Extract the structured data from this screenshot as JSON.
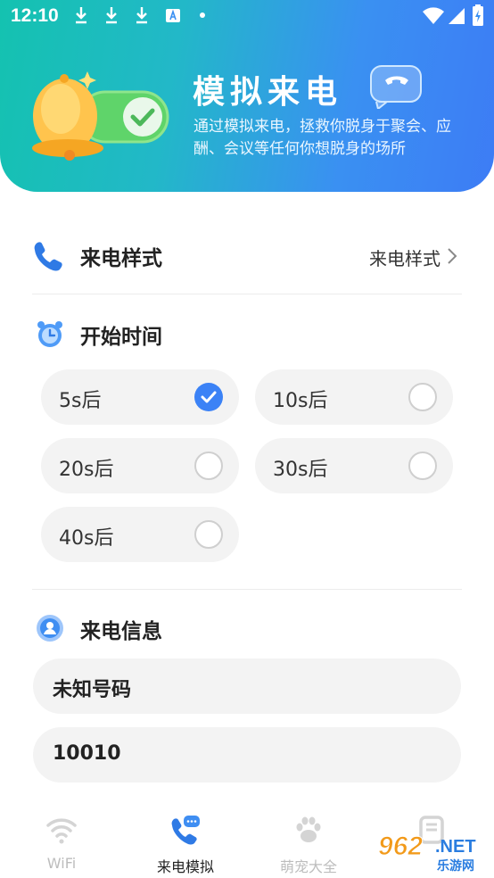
{
  "status_bar": {
    "time": "12:10"
  },
  "header": {
    "title": "模拟来电",
    "description": "通过模拟来电，拯救你脱身于聚会、应酬、会议等任何你想脱身的场所"
  },
  "call_style": {
    "label": "来电样式",
    "value": "来电样式"
  },
  "start_time": {
    "label": "开始时间",
    "options": [
      {
        "label": "5s后",
        "selected": true
      },
      {
        "label": "10s后",
        "selected": false
      },
      {
        "label": "20s后",
        "selected": false
      },
      {
        "label": "30s后",
        "selected": false
      },
      {
        "label": "40s后",
        "selected": false
      }
    ]
  },
  "caller_info": {
    "label": "来电信息",
    "name_value": "未知号码",
    "number_value": "10010"
  },
  "tabbar": {
    "tabs": [
      {
        "label": "WiFi",
        "active": false
      },
      {
        "label": "来电模拟",
        "active": true
      },
      {
        "label": "萌宠大全",
        "active": false
      }
    ]
  },
  "watermark": {
    "num": "962",
    "net": ".NET",
    "sub": "乐游网"
  },
  "colors": {
    "accent": "#3b82f6",
    "header_start": "#14c2b0",
    "header_end": "#3d7cf5"
  }
}
